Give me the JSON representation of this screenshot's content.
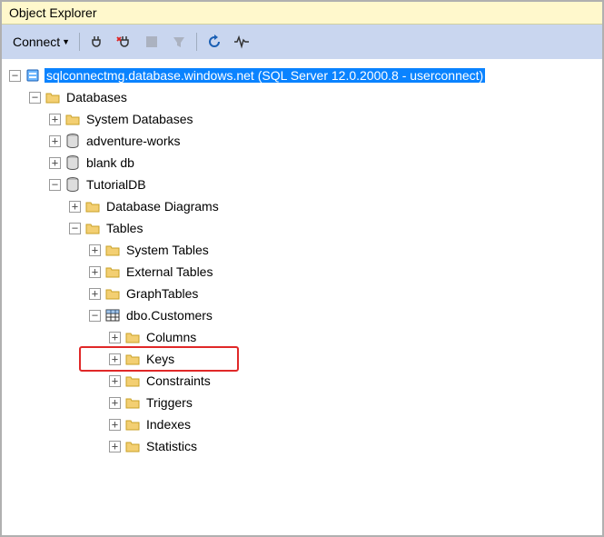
{
  "window": {
    "title": "Object Explorer"
  },
  "toolbar": {
    "connect_label": "Connect"
  },
  "tree": {
    "server": {
      "label": "sqlconnectmg.database.windows.net (SQL Server 12.0.2000.8 - userconnect)"
    },
    "databases": {
      "label": "Databases"
    },
    "system_databases": {
      "label": "System Databases"
    },
    "adventure_works": {
      "label": "adventure-works"
    },
    "blank_db": {
      "label": "blank db"
    },
    "tutorialdb": {
      "label": "TutorialDB"
    },
    "database_diagrams": {
      "label": "Database Diagrams"
    },
    "tables": {
      "label": "Tables"
    },
    "system_tables": {
      "label": "System Tables"
    },
    "external_tables": {
      "label": "External Tables"
    },
    "graph_tables": {
      "label": "GraphTables"
    },
    "dbo_customers": {
      "label": "dbo.Customers"
    },
    "columns": {
      "label": "Columns"
    },
    "keys": {
      "label": "Keys"
    },
    "constraints": {
      "label": "Constraints"
    },
    "triggers": {
      "label": "Triggers"
    },
    "indexes": {
      "label": "Indexes"
    },
    "statistics": {
      "label": "Statistics"
    }
  }
}
